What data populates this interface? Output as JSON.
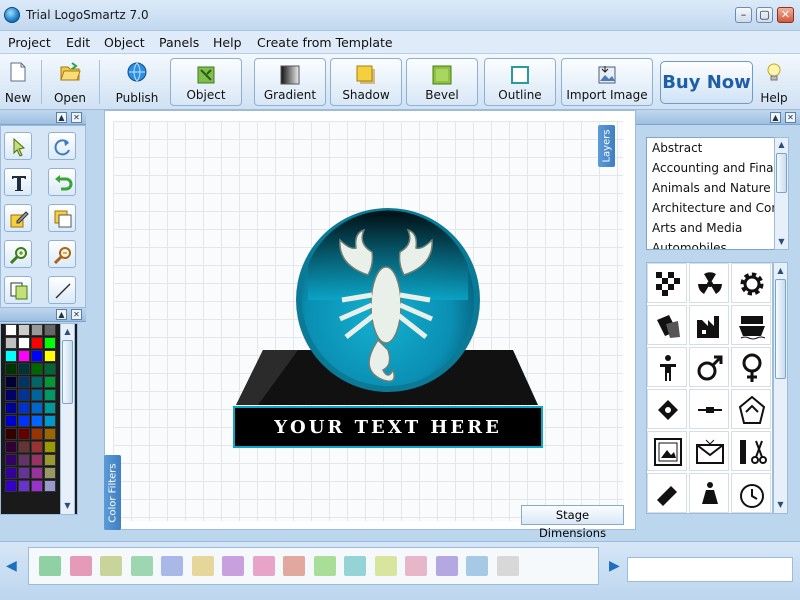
{
  "window": {
    "title": "Trial LogoSmartz 7.0",
    "min": "–",
    "max": "▢",
    "close": "✕"
  },
  "menu": [
    "Project",
    "Edit",
    "Object",
    "Panels",
    "Help",
    "Create from Template"
  ],
  "toolbar": {
    "new": "New",
    "open": "Open",
    "publish": "Publish",
    "object": "Object",
    "gradient": "Gradient",
    "shadow": "Shadow",
    "bevel": "Bevel",
    "outline": "Outline",
    "import_image": "Import Image",
    "buy_now": "Buy Now",
    "help": "Help"
  },
  "canvas": {
    "logo_text": "YOUR TEXT HERE",
    "layers_tab": "Layers",
    "color_filters_tab": "Color Filters",
    "stage_dimensions": "Stage Dimensions"
  },
  "categories": [
    "Abstract",
    "Accounting and Finance",
    "Animals and Nature",
    "Architecture and Construction",
    "Arts and Media",
    "Automobiles"
  ],
  "palette_colors": [
    "#ffffff",
    "#cccccc",
    "#999999",
    "#666666",
    "#333333",
    "#c0c0c0",
    "#ffffff",
    "#ff0000",
    "#00ff00",
    "#00ffff",
    "#ff00ff",
    "#0000ff",
    "#ffff00",
    "#003300",
    "#003333",
    "#006600",
    "#006633",
    "#000033",
    "#003366",
    "#006666",
    "#009933",
    "#000066",
    "#003399",
    "#006699",
    "#009966",
    "#000099",
    "#0033cc",
    "#0066cc",
    "#009999",
    "#0000cc",
    "#0033ff",
    "#0066ff",
    "#0099cc",
    "#330000",
    "#660000",
    "#993300",
    "#996600",
    "#330033",
    "#663333",
    "#993333",
    "#999900",
    "#330066",
    "#663366",
    "#993366",
    "#999933",
    "#330099",
    "#663399",
    "#993399",
    "#999966",
    "#3300cc",
    "#6633cc",
    "#9933cc",
    "#9999cc"
  ],
  "bottom_swatches": [
    "#8fd1a3",
    "#e59ab8",
    "#c9d49a",
    "#9fd6b2",
    "#a9b8e6",
    "#e6d69a",
    "#c9a0de",
    "#e8a3c8",
    "#e2a8a0",
    "#a9de98",
    "#96d3d6",
    "#d8e69d",
    "#e8b6c9",
    "#b3a8e2",
    "#a6c9e6",
    "#d8d8d8"
  ]
}
